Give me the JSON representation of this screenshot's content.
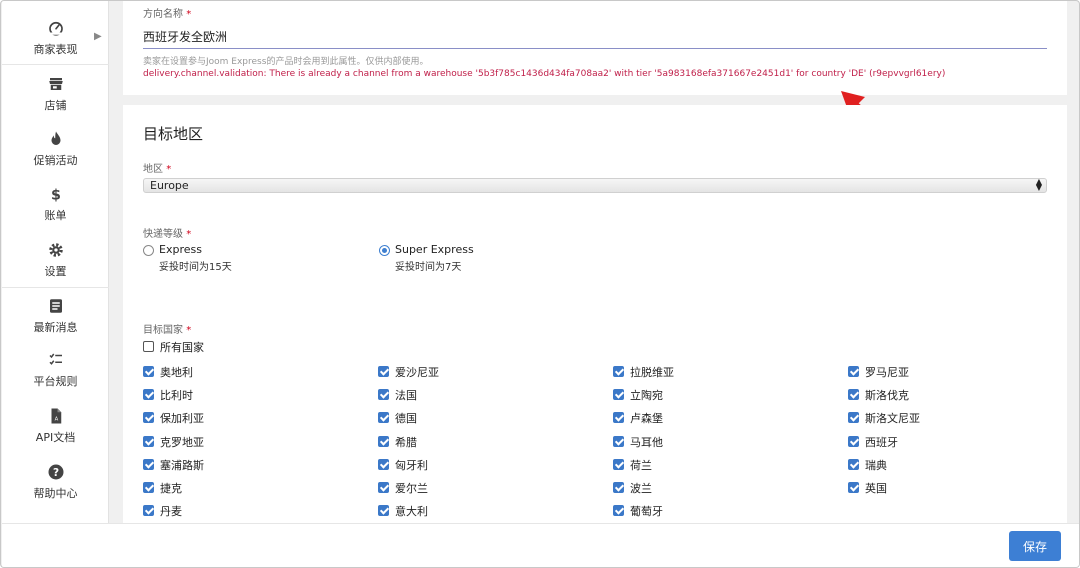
{
  "sidebar": {
    "items": [
      {
        "label": "商家表现",
        "icon": "speedometer-icon"
      },
      {
        "label": "店铺",
        "icon": "store-icon"
      },
      {
        "label": "促销活动",
        "icon": "flame-icon"
      },
      {
        "label": "账单",
        "icon": "dollar-icon"
      },
      {
        "label": "设置",
        "icon": "gear-icon"
      },
      {
        "label": "最新消息",
        "icon": "document-icon"
      },
      {
        "label": "平台规则",
        "icon": "checklist-icon"
      },
      {
        "label": "API文档",
        "icon": "file-icon"
      },
      {
        "label": "帮助中心",
        "icon": "help-icon"
      }
    ]
  },
  "direction": {
    "label": "方向名称",
    "required_mark": "*",
    "value": "西班牙发全欧洲",
    "help": "卖家在设置参与Joom Express的产品时会用到此属性。仅供内部使用。",
    "error": "delivery.channel.validation: There is already a channel from a warehouse '5b3f785c1436d434fa708aa2' with tier '5a983168efa371667e2451d1' for country 'DE' (r9epvvgrl61ery)"
  },
  "target": {
    "title": "目标地区",
    "region_label": "地区",
    "region_value": "Europe",
    "tier_label": "快递等级",
    "tiers": [
      {
        "name": "Express",
        "sub": "妥投时间为15天",
        "selected": false
      },
      {
        "name": "Super Express",
        "sub": "妥投时间为7天",
        "selected": true
      }
    ],
    "countries_label": "目标国家",
    "all_countries": "所有国家",
    "countries": [
      [
        "奥地利",
        "爱沙尼亚",
        "拉脱维亚",
        "罗马尼亚"
      ],
      [
        "比利时",
        "法国",
        "立陶宛",
        "斯洛伐克"
      ],
      [
        "保加利亚",
        "德国",
        "卢森堡",
        "斯洛文尼亚"
      ],
      [
        "克罗地亚",
        "希腊",
        "马耳他",
        "西班牙"
      ],
      [
        "塞浦路斯",
        "匈牙利",
        "荷兰",
        "瑞典"
      ],
      [
        "捷克",
        "爱尔兰",
        "波兰",
        "英国"
      ],
      [
        "丹麦",
        "意大利",
        "葡萄牙",
        ""
      ]
    ]
  },
  "footer": {
    "save_label": "保存"
  },
  "colors": {
    "accent": "#3d7fd4",
    "error": "#c0204a",
    "annotation_arrow": "#e02020"
  }
}
